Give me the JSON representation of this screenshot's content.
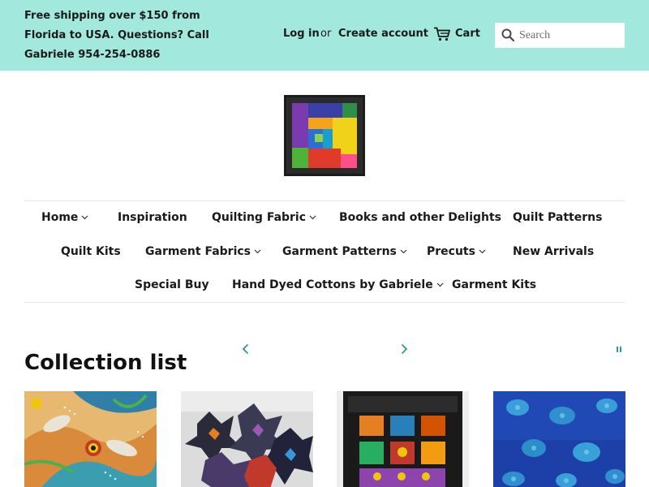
{
  "announcement": {
    "text": "Free shipping over $150 from Florida to USA. Questions? Call Gabriele 954-254-0886"
  },
  "account": {
    "login": "Log in",
    "or": "or",
    "create": "Create account",
    "cart": "Cart"
  },
  "search": {
    "placeholder": "Search"
  },
  "icons": {
    "cart": "cart-icon",
    "search": "search-icon",
    "chevron": "chevron-down-icon",
    "prev": "chevron-left-icon",
    "next": "chevron-right-icon",
    "pause": "pause-icon"
  },
  "nav": {
    "home": "Home",
    "inspiration": "Inspiration",
    "quilting_fabric": "Quilting Fabric",
    "books": "Books and other Delights",
    "quilt_patterns": "Quilt Patterns",
    "quilt_kits": "Quilt Kits",
    "garment_fabrics": "Garment Fabrics",
    "garment_patterns": "Garment Patterns",
    "precuts": "Precuts",
    "new_arrivals": "New Arrivals",
    "special_buy": "Special Buy",
    "hand_dyed": "Hand Dyed Cottons by Gabriele",
    "garment_kits": "Garment Kits"
  },
  "collection": {
    "title": "Collection list"
  },
  "colors": {
    "topbar": "#a2e8dc",
    "accent": "#2a9d8f",
    "text": "#1a1a1a"
  }
}
